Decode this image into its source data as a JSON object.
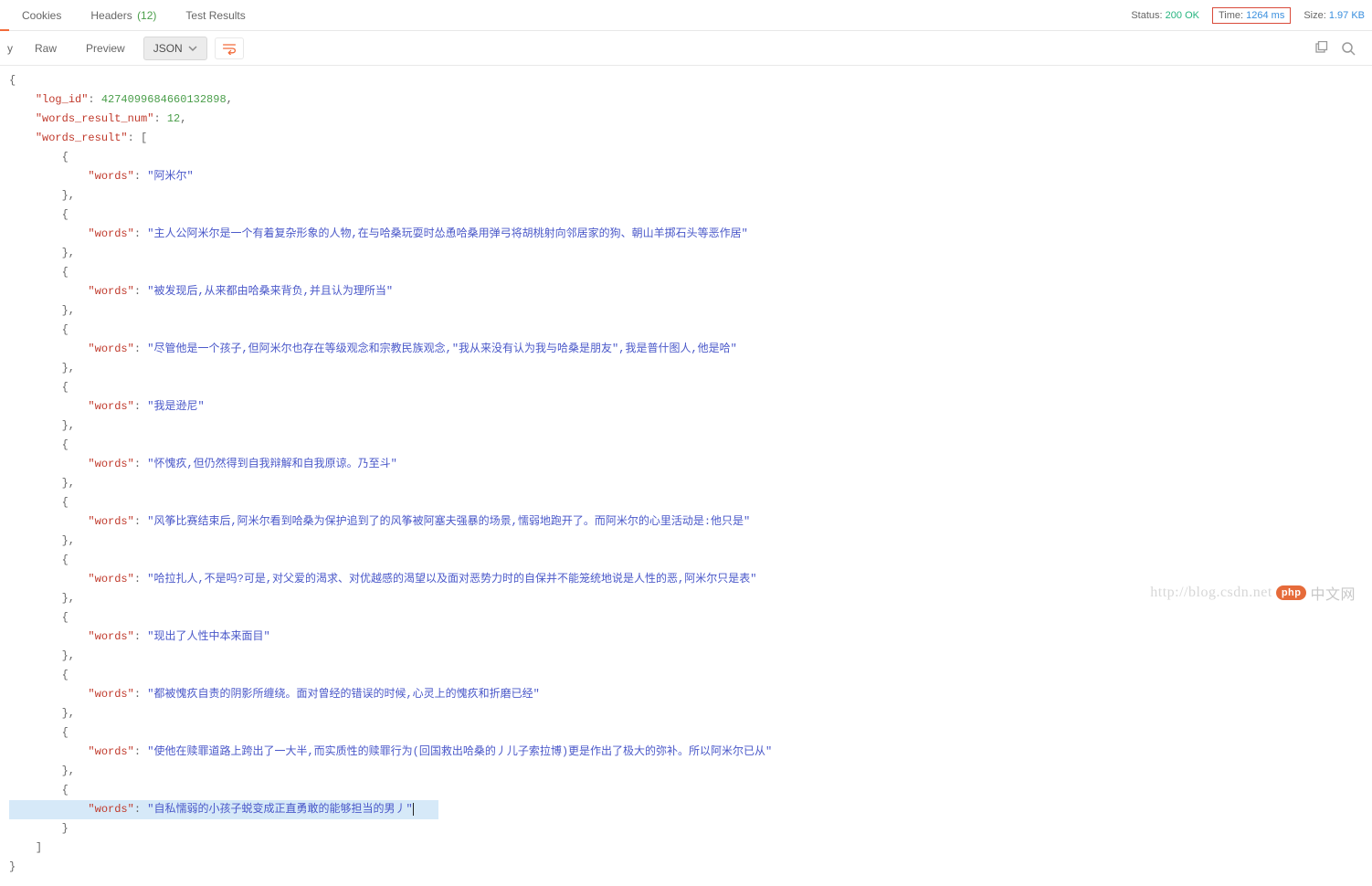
{
  "tabs": {
    "cookies": "Cookies",
    "headers": "Headers",
    "headers_count": "(12)",
    "test_results": "Test Results"
  },
  "status": {
    "status_label": "Status:",
    "status_value": "200 OK",
    "time_label": "Time:",
    "time_value": "1264 ms",
    "size_label": "Size:",
    "size_value": "1.97 KB"
  },
  "subbar": {
    "y_stub": "y",
    "raw": "Raw",
    "preview": "Preview",
    "json": "JSON"
  },
  "json": {
    "log_id_key": "\"log_id\"",
    "log_id_val": "4274099684660132898",
    "num_key": "\"words_result_num\"",
    "num_val": "12",
    "result_key": "\"words_result\"",
    "words_key": "\"words\"",
    "items": [
      "\"阿米尔\"",
      "\"主人公阿米尔是一个有着复杂形象的人物,在与哈桑玩耍时怂恿哈桑用弹弓将胡桃射向邻居家的狗、朝山羊掷石头等恶作居\"",
      "\"被发现后,从来都由哈桑来背负,并且认为理所当\"",
      "\"尽管他是一个孩子,但阿米尔也存在等级观念和宗教民族观念,\"我从来没有认为我与哈桑是朋友\",我是普什图人,他是哈\"",
      "\"我是逊尼\"",
      "\"怀愧疚,但仍然得到自我辩解和自我原谅。乃至斗\"",
      "\"风筝比赛结束后,阿米尔看到哈桑为保护追到了的风筝被阿塞夫强暴的场景,懦弱地跑开了。而阿米尔的心里活动是:他只是\"",
      "\"哈拉扎人,不是吗?可是,对父爱的渴求、对优越感的渴望以及面对恶势力时的自保并不能笼统地说是人性的恶,阿米尔只是表\"",
      "\"现出了人性中本来面目\"",
      "\"都被愧疚自责的阴影所缠绕。面对曾经的错误的时候,心灵上的愧疚和折磨已经\"",
      "\"使他在赎罪道路上跨出了一大半,而实质性的赎罪行为(回国救出哈桑的丿儿子索拉博)更是作出了极大的弥补。所以阿米尔已从\"",
      "\"自私懦弱的小孩子蜕变成正直勇敢的能够担当的男丿\""
    ]
  },
  "watermark": {
    "url": "http://blog.csdn.net",
    "badge": "php",
    "cn": "中文网"
  }
}
